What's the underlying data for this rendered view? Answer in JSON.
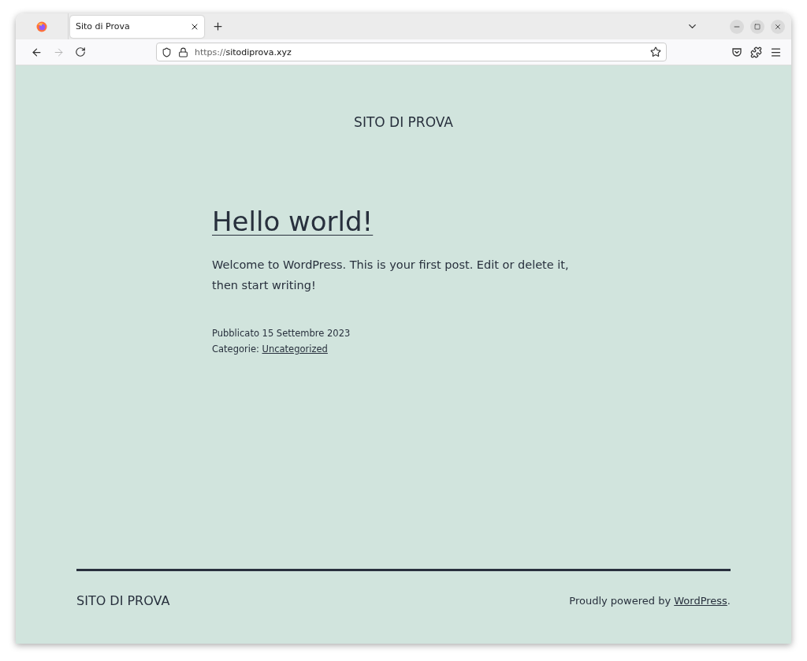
{
  "tabs": [
    {
      "title": "Sito di Prova",
      "selected": true
    }
  ],
  "nav": [
    {
      "kind": "back",
      "disabled": false
    },
    {
      "kind": "forward",
      "disabled": true
    },
    {
      "kind": "reload",
      "disabled": false
    }
  ],
  "address": {
    "scheme": "https://",
    "host": "sitodiprova.xyz"
  },
  "page": {
    "site_title": "SITO DI PROVA",
    "post_title": "Hello world!",
    "body": "Welcome to WordPress. This is your first post. Edit or delete it, then start writing!",
    "published": "Pubblicato 15 Settembre 2023",
    "categories_label": "Categorie: ",
    "category": "Uncategorized"
  },
  "footer": {
    "site_title": "SITO DI PROVA",
    "credit_prefix": "Proudly powered by ",
    "credit_link": "WordPress",
    "credit_suffix": "."
  }
}
